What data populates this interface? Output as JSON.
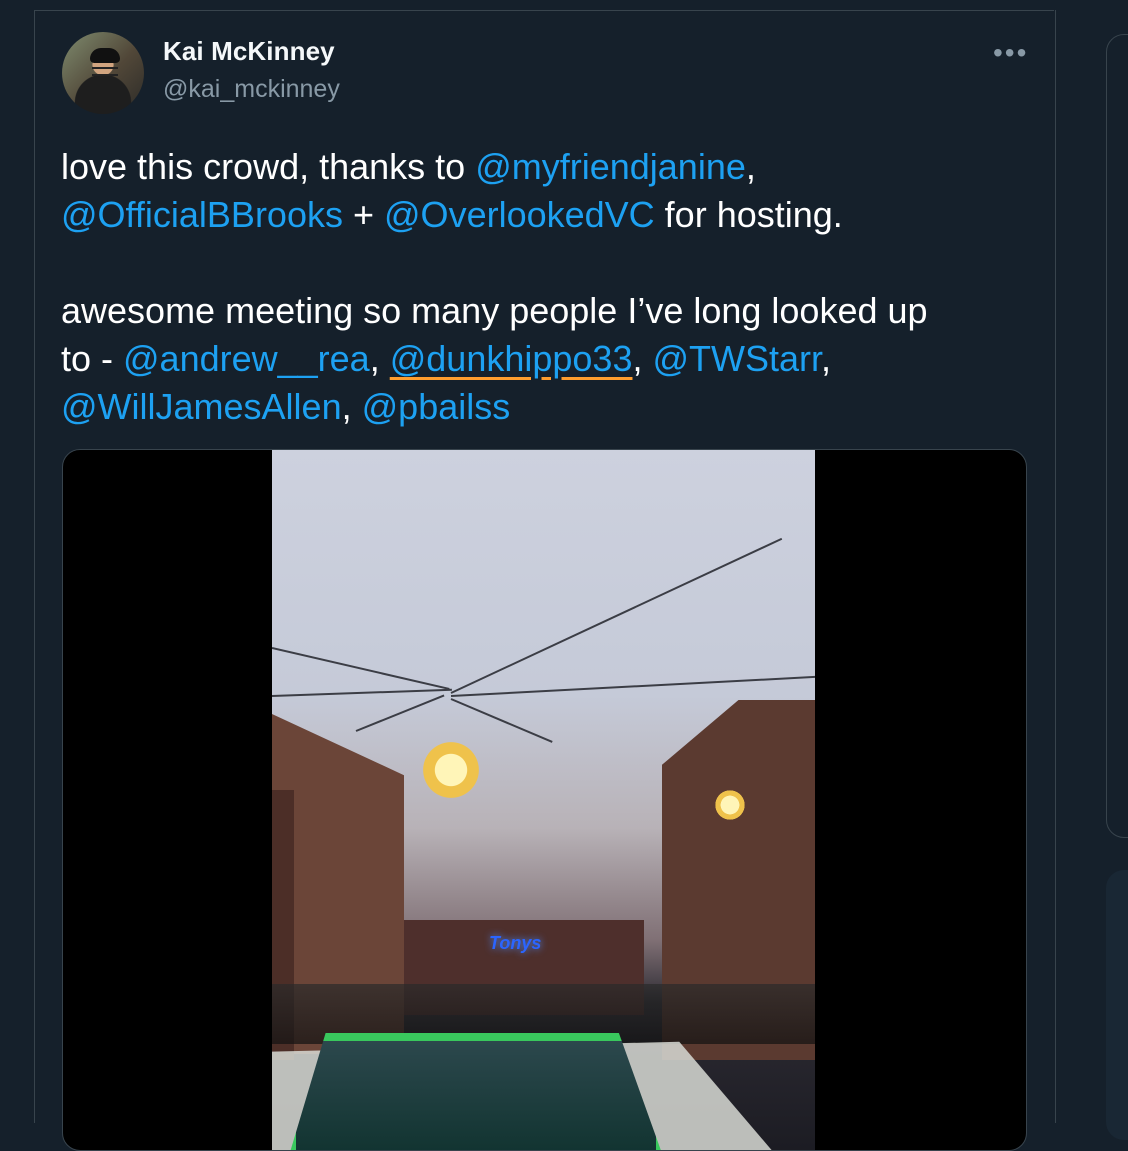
{
  "author": {
    "name": "Kai McKinney",
    "handle": "@kai_mckinney"
  },
  "menu": {
    "more_label": "•••"
  },
  "tweet": {
    "line1_pre": "love this crowd, thanks to ",
    "mention1": "@myfriendjanine",
    "line1_post": ",",
    "mention2": "@OfficialBBrooks",
    "plus": " + ",
    "mention3": "@OverlookedVC",
    "line2_post": " for hosting.",
    "line3": "awesome meeting so many people I’ve long looked up",
    "line4_pre": "to - ",
    "mention4": "@andrew__rea",
    "comma1": ", ",
    "mention5": "@dunkhippo33",
    "comma2": ", ",
    "mention6": "@TWStarr",
    "comma3": ",",
    "mention7": "@WillJamesAllen",
    "comma4": ", ",
    "mention8": "@pbailss"
  },
  "media": {
    "neon_sign": "Tonys"
  }
}
